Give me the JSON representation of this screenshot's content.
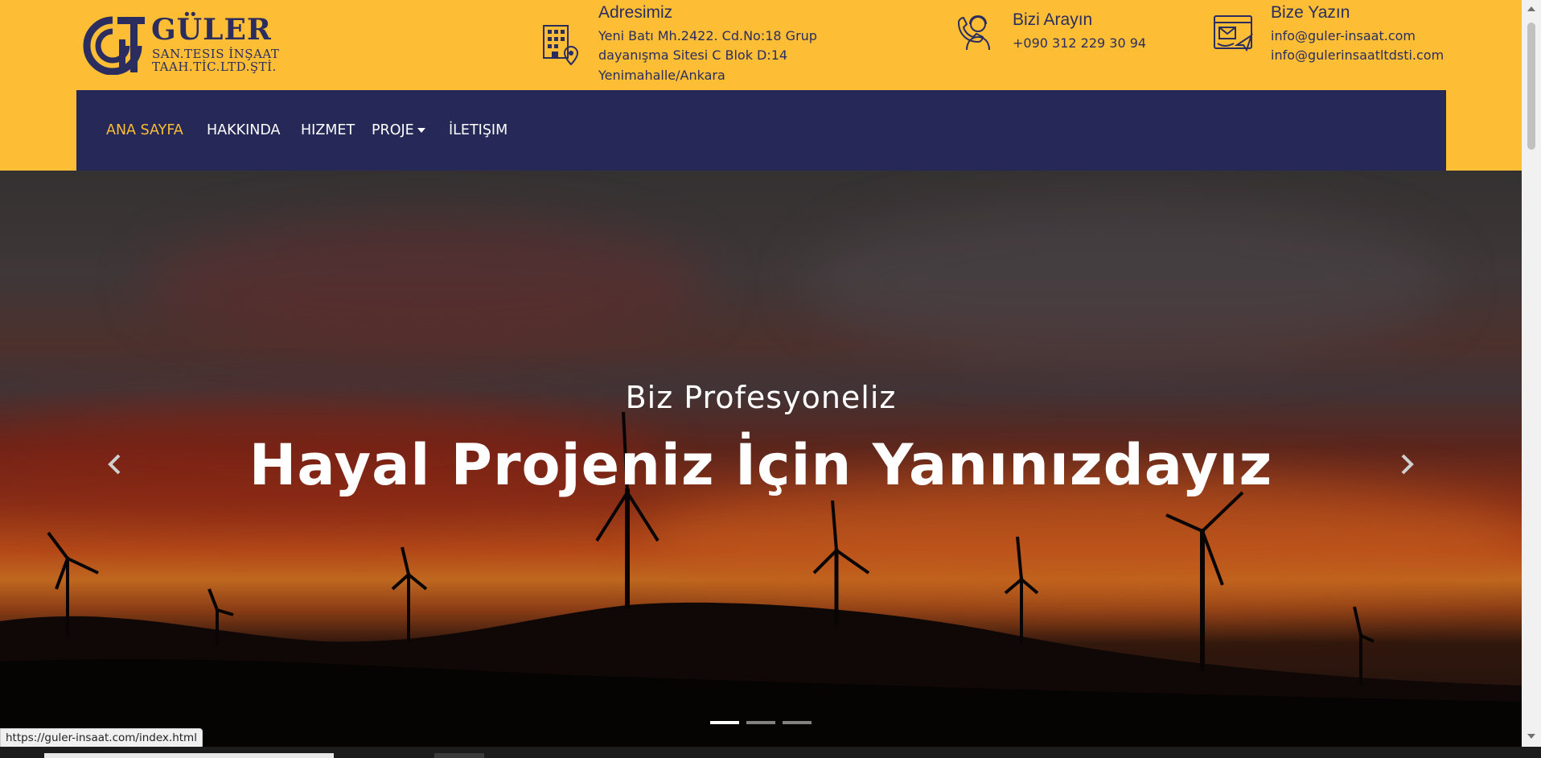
{
  "header": {
    "logo": {
      "name": "GÜLER",
      "sub1": "SAN.TESIS İNŞAAT",
      "sub2": "TAAH.TİC.LTD.ŞTİ."
    },
    "address": {
      "icon": "building-location-icon",
      "title": "Adresimiz",
      "line1": "Yeni Batı Mh.2422. Cd.No:18 Grup",
      "line2": "dayanışma Sitesi C Blok D:14",
      "line3": "Yenimahalle/Ankara"
    },
    "phone": {
      "icon": "support-agent-phone-icon",
      "title": "Bizi Arayın",
      "number": "+090 312 229 30 94"
    },
    "mail": {
      "icon": "email-send-icon",
      "title": "Bize Yazın",
      "email1": "info@guler-insaat.com",
      "email2": "info@gulerinsaatltdsti.com"
    }
  },
  "nav": {
    "items": [
      {
        "label": "ANA SAYFA",
        "active": true
      },
      {
        "label": "HAKKINDA"
      },
      {
        "label": "HIZMET"
      },
      {
        "label": "PROJE",
        "dropdown": true
      },
      {
        "label": "İLETIŞIM"
      }
    ]
  },
  "hero": {
    "subtitle": "Biz Profesyoneliz",
    "title": "Hayal Projeniz İçin Yanınızdayız",
    "slide_count": 3,
    "active_slide": 1
  },
  "status_bar": {
    "url": "https://guler-insaat.com/index.html"
  },
  "colors": {
    "accent_yellow": "#fdbd35",
    "navy": "#262858",
    "logo_navy": "#2b2d5e"
  }
}
